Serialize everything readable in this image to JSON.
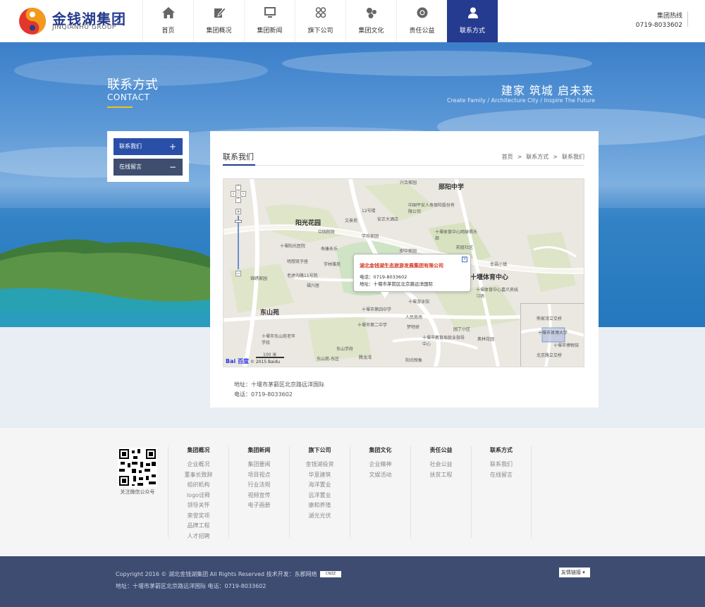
{
  "header": {
    "logo_cn": "金钱湖集团",
    "logo_en": "JINQIANHU GROUP",
    "nav": [
      {
        "label": "首页",
        "icon": "home-icon"
      },
      {
        "label": "集团概况",
        "icon": "edit-icon"
      },
      {
        "label": "集团新闻",
        "icon": "monitor-icon"
      },
      {
        "label": "旗下公司",
        "icon": "grid-icon"
      },
      {
        "label": "集团文化",
        "icon": "bubbles-icon"
      },
      {
        "label": "责任公益",
        "icon": "chrome-icon"
      },
      {
        "label": "联系方式",
        "icon": "user-icon",
        "active": true
      }
    ],
    "hotline_label": "集团热线",
    "hotline_number": "0719-8033602"
  },
  "banner": {
    "title": "联系方式",
    "subtitle": "CONTACT",
    "slogan": "建家  筑城  启未来",
    "slogan_en": "Create Family  /  Architecture City  /  Inspire The Future"
  },
  "side_menu": [
    {
      "label": "联系我们",
      "sign": "+"
    },
    {
      "label": "在线留言",
      "sign": "−"
    }
  ],
  "panel": {
    "title": "联系我们",
    "breadcrumb": [
      "首页",
      "联系方式",
      "联系我们"
    ],
    "breadcrumb_sep": ">",
    "address": "地址：十堰市茅箭区北京路远洋国际",
    "phone": "电话：0719-8033602"
  },
  "map": {
    "popup_title": "湖北金钱湖生态旅游发展集团有限公司",
    "popup_phone": "电话：0719-8033602",
    "popup_address": "地址：十堰市茅箭区北京路远洋国际",
    "labels_big": [
      "郧阳中学",
      "阳光花园",
      "十堰体育中心",
      "东山苑"
    ],
    "labels": [
      "兴合家园",
      "中国平安人寿保险股份有限公司",
      "12号楼",
      "中国邮政",
      "文景苑",
      "安正大酒店",
      "学府家园",
      "十堰体育中心网球俱乐部",
      "十堰阳光医院",
      "寿康永乐",
      "即中家园",
      "前庭社区",
      "明想双子座",
      "学林雅苑",
      "老虎沟路11号院",
      "福兴居",
      "锦绣家园",
      "十堰体育中心嘉爪夹线习场",
      "十堰游泳馆",
      "人民商场",
      "十堰市第二中学",
      "梦特娇",
      "园丁小区",
      "十堰市东山苑老年学校",
      "十堰市教育局就业指导中心",
      "东山学府",
      "东山苑-东区",
      "腾龙湾",
      "阳光映象",
      "幸福小镇",
      "奥林花园",
      "十堰市第四中学",
      "熊家湾立交桥",
      "北京路立交桥",
      "十堰市博物馆",
      "十堰市首博大学"
    ],
    "scale_text": "100 米",
    "copyright": "© 2015 Baidu",
    "logo": "Bai 百度"
  },
  "footer": {
    "qr_caption": "关注微信公众号",
    "columns": [
      {
        "title": "集团概况",
        "links": [
          "企业概况",
          "董事长致辞",
          "组织机构",
          "logo诠释",
          "领导关怀",
          "荣誉奖项",
          "品牌工程",
          "人才招聘"
        ]
      },
      {
        "title": "集团新闻",
        "links": [
          "集团要闻",
          "项目视点",
          "行业法规",
          "视频宣传",
          "电子画册"
        ]
      },
      {
        "title": "旗下公司",
        "links": [
          "金钱湖投资",
          "华意建筑",
          "海洋置业",
          "远洋置业",
          "康和养殖",
          "湖光光伏"
        ]
      },
      {
        "title": "集团文化",
        "links": [
          "企业精神",
          "文娱活动"
        ]
      },
      {
        "title": "责任公益",
        "links": [
          "社会公益",
          "扶贫工程"
        ]
      },
      {
        "title": "联系方式",
        "links": [
          "联系我们",
          "在线留言"
        ]
      }
    ],
    "copyright": "Copyright 2016 ©  湖北金钱湖集团   All Rights Reserved   技术开发：东郡网络",
    "cnzz": "CNZZ",
    "address": "地址：十堰市茅箭区北京路远洋国际   电话：0719-8033602",
    "friend_links": "友情链接 ▾"
  },
  "colors": {
    "brand_blue": "#243b8f",
    "accent_yellow": "#f1c21b",
    "footer_bar": "#3e4c72",
    "popup_red": "#d4321e"
  }
}
